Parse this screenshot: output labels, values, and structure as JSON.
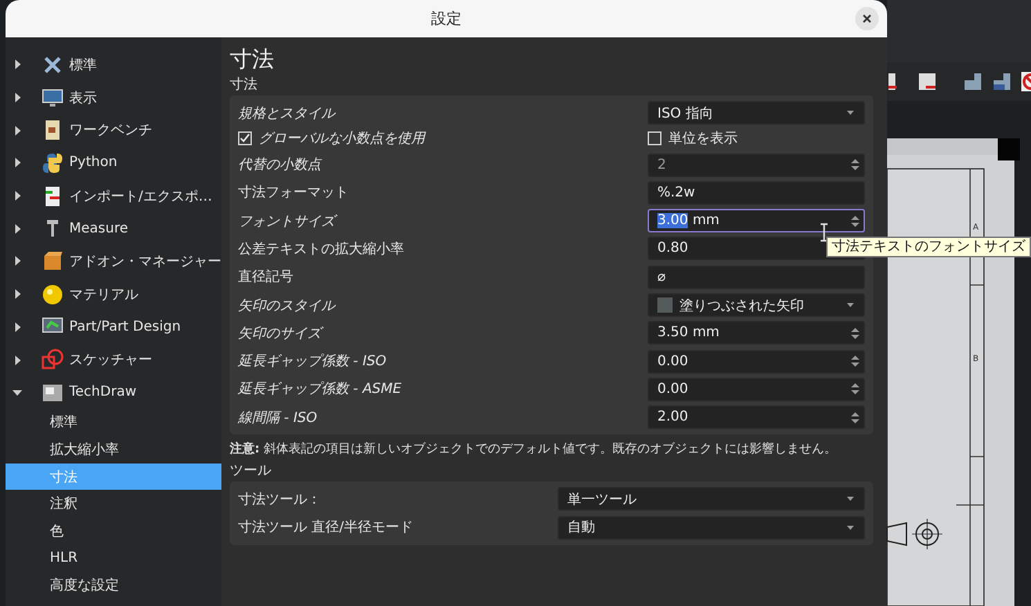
{
  "window": {
    "title": "設定"
  },
  "sidebar": {
    "items": [
      {
        "label": "標準",
        "expanded": false
      },
      {
        "label": "表示",
        "expanded": false
      },
      {
        "label": "ワークベンチ",
        "expanded": false
      },
      {
        "label": "Python",
        "expanded": false
      },
      {
        "label": "インポート/エクスポ…",
        "expanded": false
      },
      {
        "label": "Measure",
        "expanded": false
      },
      {
        "label": "アドオン・マネージャー",
        "expanded": false
      },
      {
        "label": "マテリアル",
        "expanded": false
      },
      {
        "label": "Part/Part Design",
        "expanded": false
      },
      {
        "label": "スケッチャー",
        "expanded": false
      },
      {
        "label": "TechDraw",
        "expanded": true,
        "children": [
          {
            "label": "標準",
            "selected": false
          },
          {
            "label": "拡大縮小率",
            "selected": false
          },
          {
            "label": "寸法",
            "selected": true
          },
          {
            "label": "注釈",
            "selected": false
          },
          {
            "label": "色",
            "selected": false
          },
          {
            "label": "HLR",
            "selected": false
          },
          {
            "label": "高度な設定",
            "selected": false
          }
        ]
      }
    ]
  },
  "page": {
    "title": "寸法"
  },
  "groups": [
    {
      "label": "寸法",
      "rows": [
        {
          "kind": "combo",
          "label": "規格とスタイル",
          "italic": true,
          "value": "ISO 指向"
        },
        {
          "kind": "checkbox-pair",
          "label": "グローバルな小数点を使用",
          "italic": true,
          "checked": true,
          "label_2": "単位を表示",
          "checked_2": false
        },
        {
          "kind": "spin",
          "label": "代替の小数点",
          "italic": true,
          "value": "2",
          "disabled": true,
          "focused": false
        },
        {
          "kind": "text",
          "label": "寸法フォーマット",
          "italic": false,
          "value": "%.2w"
        },
        {
          "kind": "spin",
          "label": "フォントサイズ",
          "italic": true,
          "value": "3.00",
          "suffix": "mm",
          "disabled": false,
          "focused": true
        },
        {
          "kind": "spin",
          "label": "公差テキストの拡大縮小率",
          "italic": false,
          "value": "0.80",
          "disabled": false,
          "focused": false
        },
        {
          "kind": "text",
          "label": "直径記号",
          "italic": false,
          "value": "⌀"
        },
        {
          "kind": "combo-swatch",
          "label": "矢印のスタイル",
          "italic": true,
          "value": "塗りつぶされた矢印"
        },
        {
          "kind": "spin",
          "label": "矢印のサイズ",
          "italic": true,
          "value": "3.50",
          "suffix": "mm",
          "disabled": false,
          "focused": false
        },
        {
          "kind": "spin",
          "label": "延長ギャップ係数 - ISO",
          "italic": true,
          "value": "0.00",
          "disabled": false,
          "focused": false
        },
        {
          "kind": "spin",
          "label": "延長ギャップ係数 - ASME",
          "italic": true,
          "value": "0.00",
          "disabled": false,
          "focused": false
        },
        {
          "kind": "spin",
          "label": "線間隔 - ISO",
          "italic": true,
          "value": "2.00",
          "disabled": false,
          "focused": false
        }
      ],
      "note": "**注意:** 斜体表記の項目は新しいオブジェクトでのデフォルト値です。既存のオブジェクトには影響しません。"
    },
    {
      "label": "ツール",
      "rows": [
        {
          "kind": "combo",
          "label": "寸法ツール：",
          "italic": false,
          "value": "単一ツール"
        },
        {
          "kind": "combo",
          "label": "寸法ツール 直径/半径モード",
          "italic": false,
          "value": "自動"
        }
      ]
    }
  ],
  "tooltip": {
    "text": "寸法テキストのフォントサイズ"
  },
  "drawing": {
    "row_labels": [
      "A",
      "B"
    ]
  }
}
